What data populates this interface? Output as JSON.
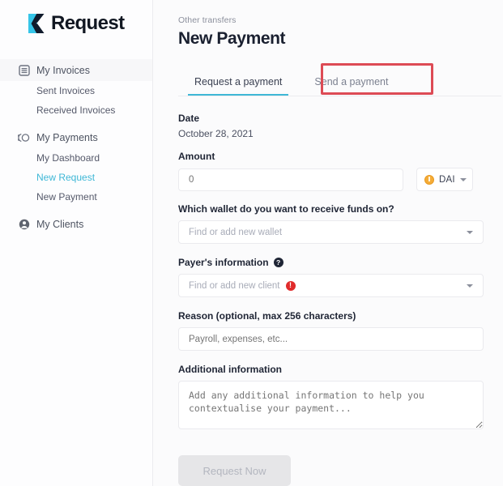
{
  "brand": {
    "name": "Request",
    "logo_icon": "request-r-logo-icon",
    "logo_color": "#36c5e8"
  },
  "sidebar": {
    "groups": [
      {
        "label": "My Invoices",
        "icon": "invoice-list-icon",
        "active_row": true,
        "children": [
          {
            "label": "Sent Invoices",
            "active": false
          },
          {
            "label": "Received Invoices",
            "active": false
          }
        ]
      },
      {
        "label": "My Payments",
        "icon": "coins-icon",
        "active_row": false,
        "children": [
          {
            "label": "My Dashboard",
            "active": false
          },
          {
            "label": "New Request",
            "active": true
          },
          {
            "label": "New Payment",
            "active": false
          }
        ]
      },
      {
        "label": "My Clients",
        "icon": "user-circle-icon",
        "active_row": false,
        "children": []
      }
    ]
  },
  "header": {
    "eyebrow": "Other transfers",
    "title": "New Payment"
  },
  "tabs": [
    {
      "label": "Request a payment",
      "active": true,
      "annotated": true
    },
    {
      "label": "Send a payment",
      "active": false,
      "annotated": false
    }
  ],
  "form": {
    "date": {
      "label": "Date",
      "value": "October 28, 2021"
    },
    "amount": {
      "label": "Amount",
      "placeholder": "0",
      "value": ""
    },
    "currency": {
      "selected": "DAI",
      "icon": "dai-coin-icon",
      "icon_color": "#f5ac37",
      "caret_icon": "chevron-down-icon"
    },
    "wallet": {
      "label": "Which wallet do you want to receive funds on?",
      "placeholder": "Find or add new wallet",
      "value": "",
      "caret_icon": "chevron-down-icon"
    },
    "payer": {
      "label": "Payer's information",
      "help_icon": "help-question-icon",
      "help_glyph": "?",
      "placeholder": "Find or add new client",
      "value": "",
      "error_icon": "error-exclamation-icon",
      "error_glyph": "!",
      "error_color": "#e02b2b",
      "caret_icon": "chevron-down-icon"
    },
    "reason": {
      "label": "Reason (optional, max 256 characters)",
      "placeholder": "Payroll, expenses, etc...",
      "value": ""
    },
    "additional": {
      "label": "Additional information",
      "placeholder": "Add any additional information to help you contextualise your payment...",
      "value": ""
    },
    "submit": {
      "label": "Request Now",
      "disabled": true
    }
  },
  "annotation": {
    "color": "#dd4b55"
  },
  "theme": {
    "accent": "#3eb7d6",
    "page_bg": "#fbfbfc",
    "panel_bg": "#ffffff"
  }
}
